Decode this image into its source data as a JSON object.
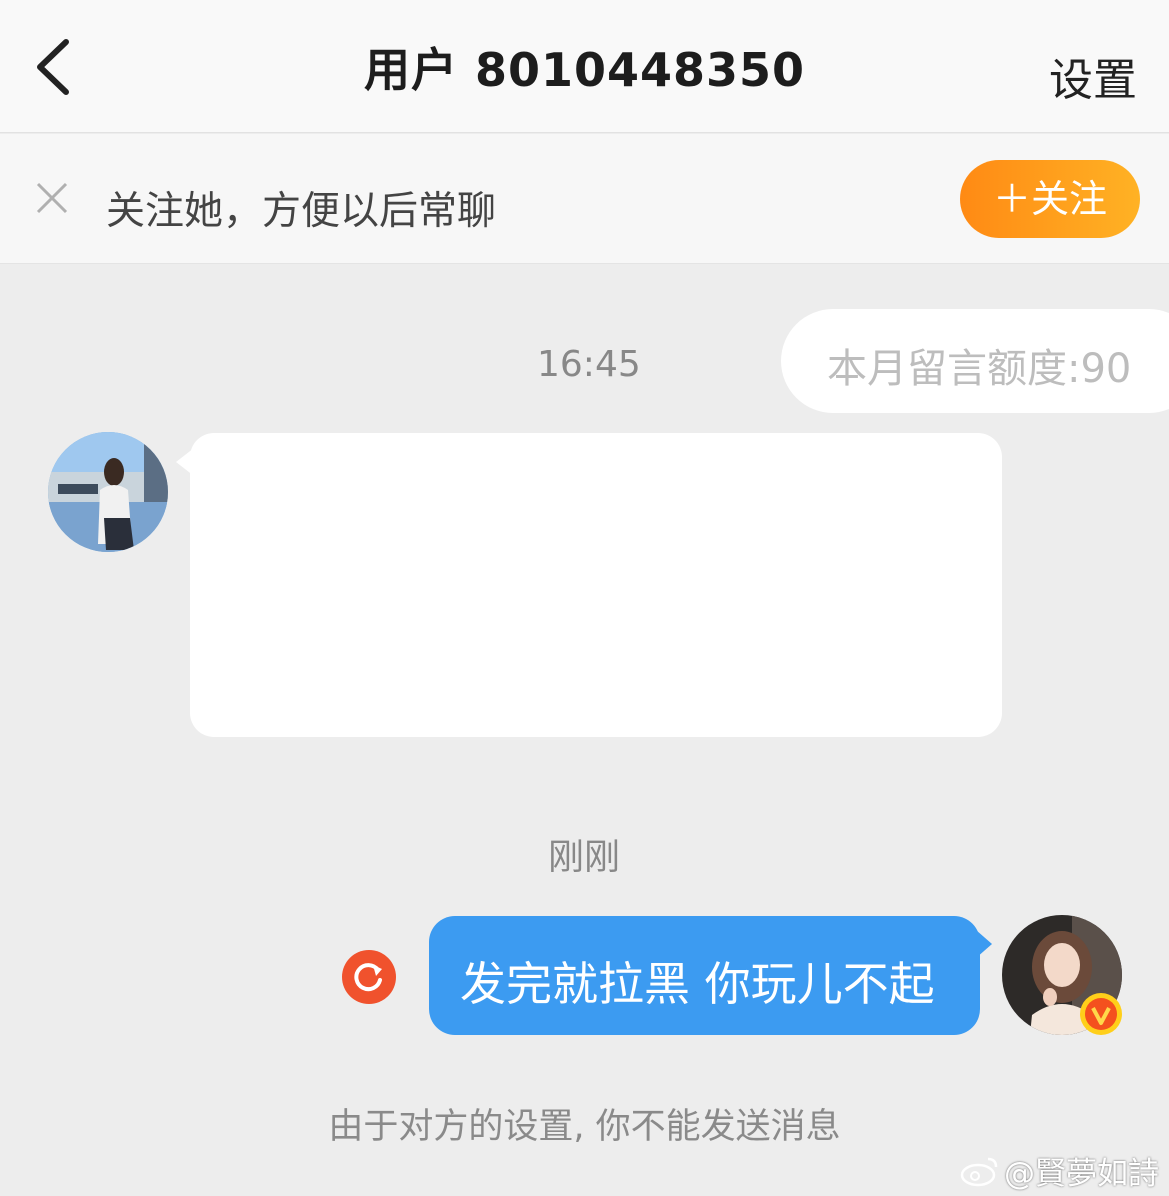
{
  "header": {
    "title": "用户 8010448350",
    "settings_label": "设置",
    "back_icon": "chevron-left-icon"
  },
  "follow_bar": {
    "prompt": "关注她，方便以后常聊",
    "follow_button": "＋关注",
    "close_icon": "close-icon",
    "accent_color": "#ff9a1a"
  },
  "conversation": {
    "quota_text": "本月留言额度:90",
    "timestamp_1": "16:45",
    "timestamp_2": "刚刚",
    "outgoing_message": "发完就拉黑 你玩儿不起",
    "outgoing_bubble_color": "#3c9bf1",
    "retry_icon": "retry-icon",
    "block_notice": "由于对方的设置, 你不能发送消息"
  },
  "watermark": {
    "text": "@賢夢如詩",
    "icon": "weibo-icon"
  }
}
